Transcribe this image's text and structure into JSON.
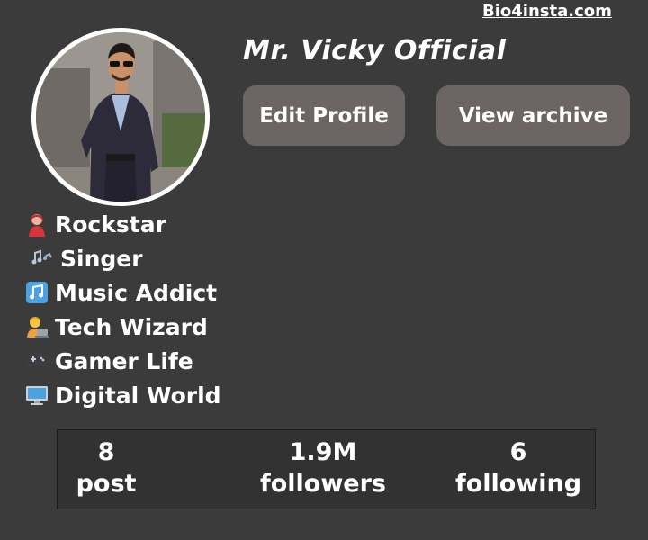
{
  "watermark": "Bio4insta.com",
  "profile": {
    "name": "Mr. Vicky Official",
    "edit_label": "Edit Profile",
    "archive_label": "View archive"
  },
  "bio": [
    {
      "icon": "rockstar-emoji-icon",
      "text": "Rockstar"
    },
    {
      "icon": "music-notes-emoji-icon",
      "text": "Singer"
    },
    {
      "icon": "music-note-emoji-icon",
      "text": "Music Addict"
    },
    {
      "icon": "technologist-emoji-icon",
      "text": "Tech Wizard"
    },
    {
      "icon": "gamepad-emoji-icon",
      "text": "Gamer Life"
    },
    {
      "icon": "computer-emoji-icon",
      "text": "Digital World"
    }
  ],
  "stats": {
    "post_count": "8",
    "post_label": "post",
    "followers_count": "1.9M",
    "followers_label": "followers",
    "following_count": "6",
    "following_label": "following"
  },
  "colors": {
    "background": "#3b3b3b",
    "button": "#6d6564",
    "stats_panel": "#323232"
  }
}
